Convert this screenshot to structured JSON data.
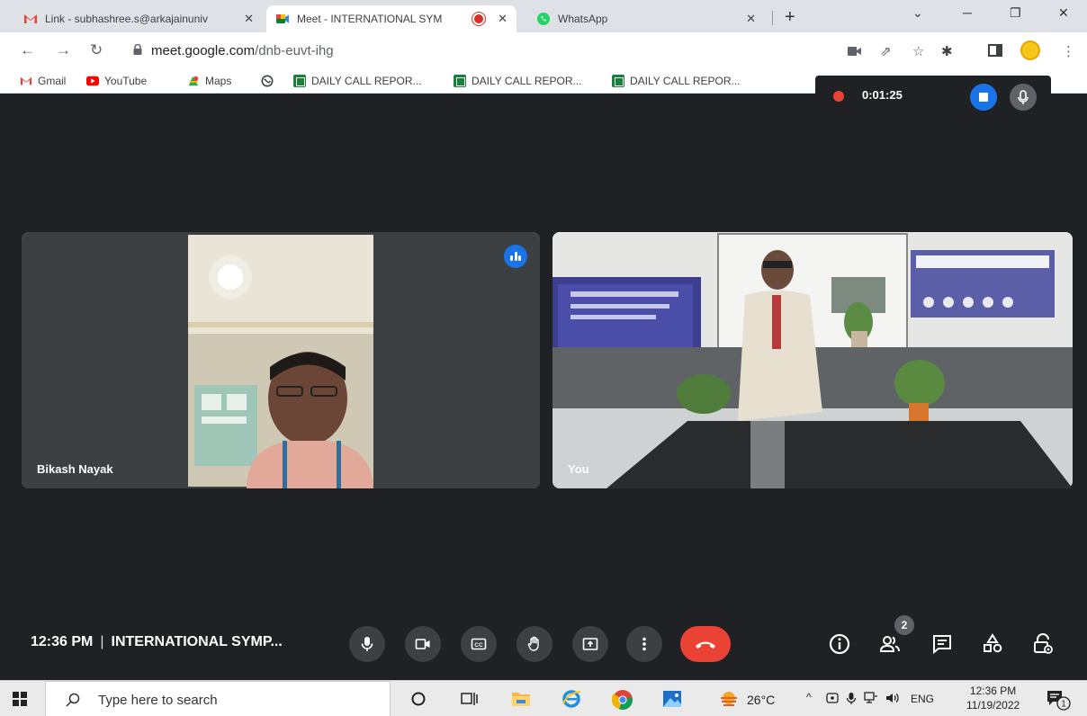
{
  "browser": {
    "tabs": [
      {
        "title": "Link - subhashree.s@arkajainuniv",
        "active": false
      },
      {
        "title": "Meet - INTERNATIONAL SYM",
        "active": true
      },
      {
        "title": "WhatsApp",
        "active": false
      }
    ],
    "url_host": "meet.google.com",
    "url_path": "/dnb-euvt-ihg",
    "bookmarks": [
      "Gmail",
      "YouTube",
      "Maps",
      "DAILY CALL REPOR...",
      "DAILY CALL REPOR...",
      "DAILY CALL REPOR..."
    ]
  },
  "recording": {
    "timer": "0:01:25"
  },
  "meet": {
    "participants": [
      {
        "name": "Bikash Nayak",
        "speaking": true
      },
      {
        "name": "You",
        "speaking": false
      }
    ],
    "time": "12:36 PM",
    "separator": "|",
    "meeting_title": "INTERNATIONAL SYMP...",
    "people_count": "2"
  },
  "taskbar": {
    "search_placeholder": "Type here to search",
    "weather": "26°C",
    "language": "ENG",
    "clock_time": "12:36 PM",
    "clock_date": "11/19/2022",
    "notification_count": "1"
  },
  "colors": {
    "end_call": "#ea4335",
    "accent": "#1a73e8",
    "speaking_outline": "#8ab4f8",
    "meet_bg": "#202124"
  }
}
